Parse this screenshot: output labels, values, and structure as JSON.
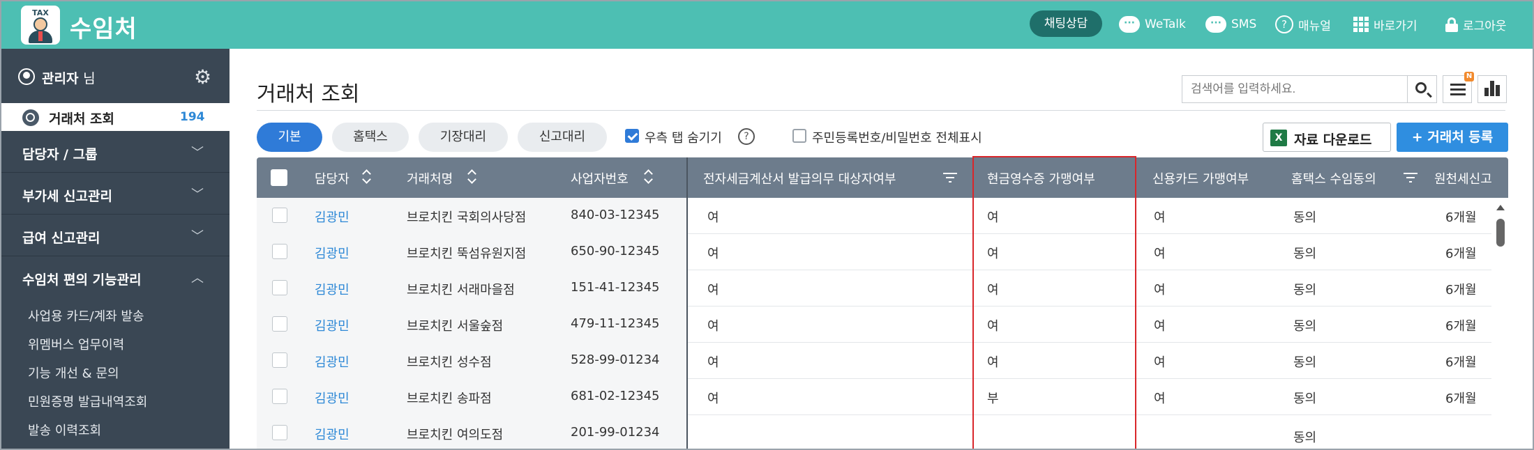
{
  "header": {
    "logo_text": "TAX",
    "app_title": "수임처",
    "chat_button": "채팅상담",
    "nav": [
      {
        "label": "WeTalk",
        "icon": "wetalk-icon"
      },
      {
        "label": "SMS",
        "icon": "sms-icon"
      },
      {
        "label": "매뉴얼",
        "icon": "help-icon"
      },
      {
        "label": "바로가기",
        "icon": "grid-icon"
      },
      {
        "label": "로그아웃",
        "icon": "lock-icon"
      }
    ]
  },
  "sidebar": {
    "user": "관리자",
    "user_suffix": "님",
    "active_item": {
      "label": "거래처 조회",
      "count": "194"
    },
    "sections": [
      {
        "label": "담당자 / 그룹",
        "expanded": false
      },
      {
        "label": "부가세 신고관리",
        "expanded": false
      },
      {
        "label": "급여 신고관리",
        "expanded": false
      },
      {
        "label": "수임처 편의 기능관리",
        "expanded": true
      }
    ],
    "sub_items": [
      "사업용 카드/계좌 발송",
      "위멤버스 업무이력",
      "기능 개선 & 문의",
      "민원증명 발급내역조회",
      "발송 이력조회"
    ]
  },
  "main": {
    "title": "거래처 조회",
    "search_placeholder": "검색어를 입력하세요.",
    "list_badge": "N",
    "tabs": [
      "기본",
      "홈택스",
      "기장대리",
      "신고대리"
    ],
    "active_tab": "기본",
    "opt_hide_tab": {
      "label": "우측 탭 숨기기",
      "checked": true
    },
    "opt_show_all": {
      "label": "주민등록번호/비밀번호 전체표시",
      "checked": false
    },
    "help_glyph": "?",
    "excel_glyph": "X",
    "download_label": "자료 다운로드",
    "register_label": "+ 거래처 등록"
  },
  "table": {
    "columns": [
      "담당자",
      "거래처명",
      "사업자번호",
      "전자세금계산서 발급의무 대상자여부",
      "현금영수증 가맹여부",
      "신용카드 가맹여부",
      "홈택스 수임동의",
      "원천세신고"
    ],
    "rows": [
      {
        "manager": "김광민",
        "name": "브로치킨 국회의사당점",
        "biz_no": "840-03-12345",
        "etax": "여",
        "cash": "여",
        "card": "여",
        "consent": "동의",
        "withholding": "6개월"
      },
      {
        "manager": "김광민",
        "name": "브로치킨 뚝섬유원지점",
        "biz_no": "650-90-12345",
        "etax": "여",
        "cash": "여",
        "card": "여",
        "consent": "동의",
        "withholding": "6개월"
      },
      {
        "manager": "김광민",
        "name": "브로치킨 서래마을점",
        "biz_no": "151-41-12345",
        "etax": "여",
        "cash": "여",
        "card": "여",
        "consent": "동의",
        "withholding": "6개월"
      },
      {
        "manager": "김광민",
        "name": "브로치킨 서울숲점",
        "biz_no": "479-11-12345",
        "etax": "여",
        "cash": "여",
        "card": "여",
        "consent": "동의",
        "withholding": "6개월"
      },
      {
        "manager": "김광민",
        "name": "브로치킨 성수점",
        "biz_no": "528-99-01234",
        "etax": "여",
        "cash": "여",
        "card": "여",
        "consent": "동의",
        "withholding": "6개월"
      },
      {
        "manager": "김광민",
        "name": "브로치킨 송파점",
        "biz_no": "681-02-12345",
        "etax": "여",
        "cash": "부",
        "card": "여",
        "consent": "동의",
        "withholding": "6개월"
      },
      {
        "manager": "김광민",
        "name": "브로치킨 여의도점",
        "biz_no": "201-99-01234",
        "etax": "",
        "cash": "",
        "card": "",
        "consent": "동의",
        "withholding": ""
      }
    ]
  },
  "colors": {
    "header_bg": "#4dbfb3",
    "sidebar_bg": "#3a4754",
    "accent": "#2f7bd8",
    "highlight": "#d9262a"
  }
}
